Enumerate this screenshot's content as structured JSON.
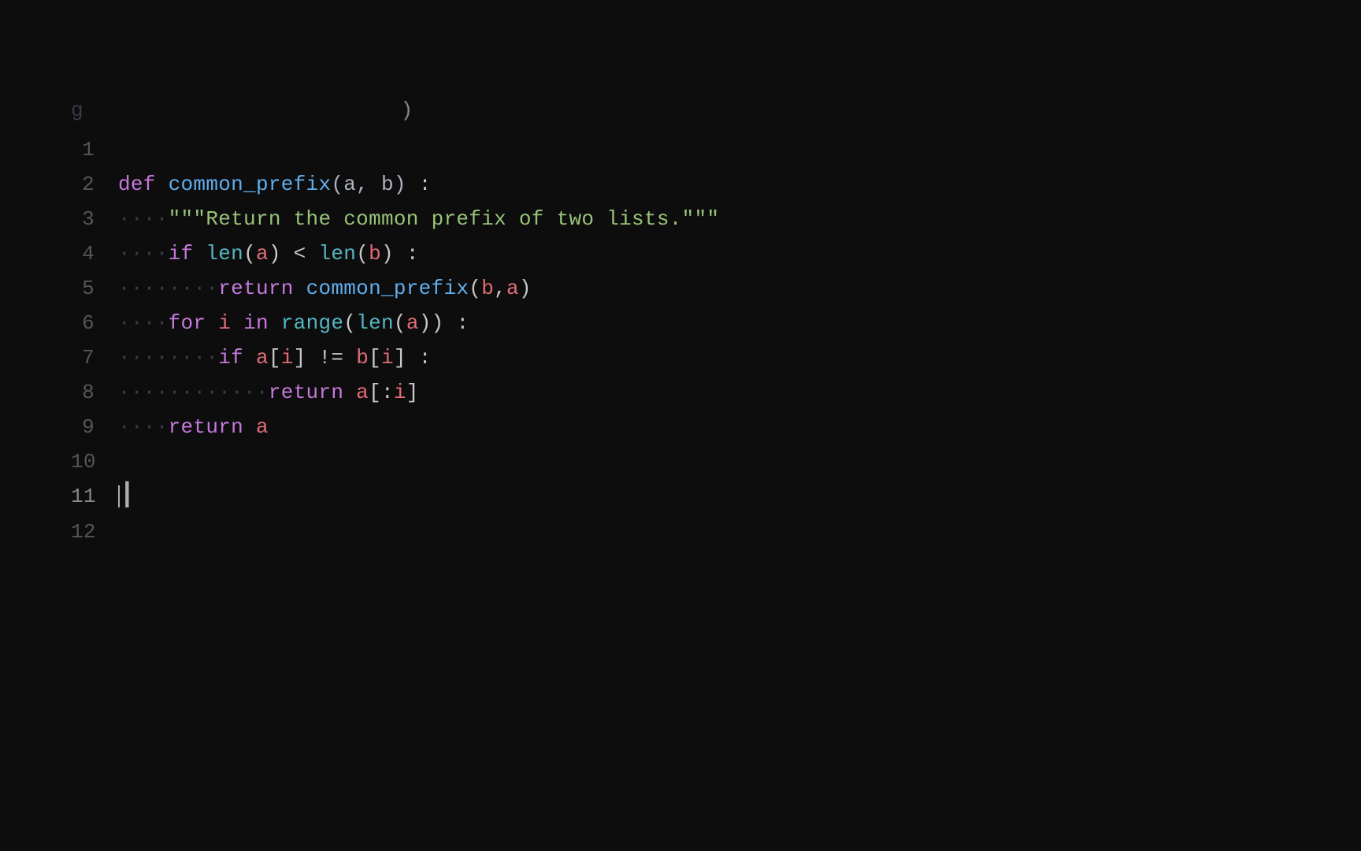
{
  "editor": {
    "background": "#0d0d0d",
    "font_size": "26px",
    "lines": [
      {
        "num": "",
        "content": "partial_top",
        "type": "partial"
      },
      {
        "num": "1",
        "content": "",
        "type": "empty"
      },
      {
        "num": "2",
        "content": "def_line",
        "type": "def"
      },
      {
        "num": "3",
        "content": "docstring_line",
        "type": "docstring"
      },
      {
        "num": "4",
        "content": "if_len_line",
        "type": "if_len"
      },
      {
        "num": "5",
        "content": "return_recursive_line",
        "type": "return_recursive"
      },
      {
        "num": "6",
        "content": "for_line",
        "type": "for"
      },
      {
        "num": "7",
        "content": "if_neq_line",
        "type": "if_neq"
      },
      {
        "num": "8",
        "content": "return_slice_line",
        "type": "return_slice"
      },
      {
        "num": "9",
        "content": "return_a_line",
        "type": "return_a"
      },
      {
        "num": "10",
        "content": "",
        "type": "empty"
      },
      {
        "num": "11",
        "content": "cursor_line",
        "type": "cursor"
      },
      {
        "num": "12",
        "content": "",
        "type": "empty"
      }
    ],
    "partial_text": "g                        )",
    "def_keyword": "def",
    "fn_name": "common_prefix",
    "params": "(a, b)",
    "colon": " :",
    "docstring": "\"\"\"Return the common prefix of two lists.\"\"\"",
    "dots4": "····",
    "dots8": "········",
    "dots12": "············",
    "if_keyword": "if",
    "len_builtin": "len",
    "for_keyword": "for",
    "in_keyword": "in",
    "range_builtin": "range",
    "return_keyword": "return",
    "neq_operator": "!=",
    "lt_operator": "<"
  }
}
